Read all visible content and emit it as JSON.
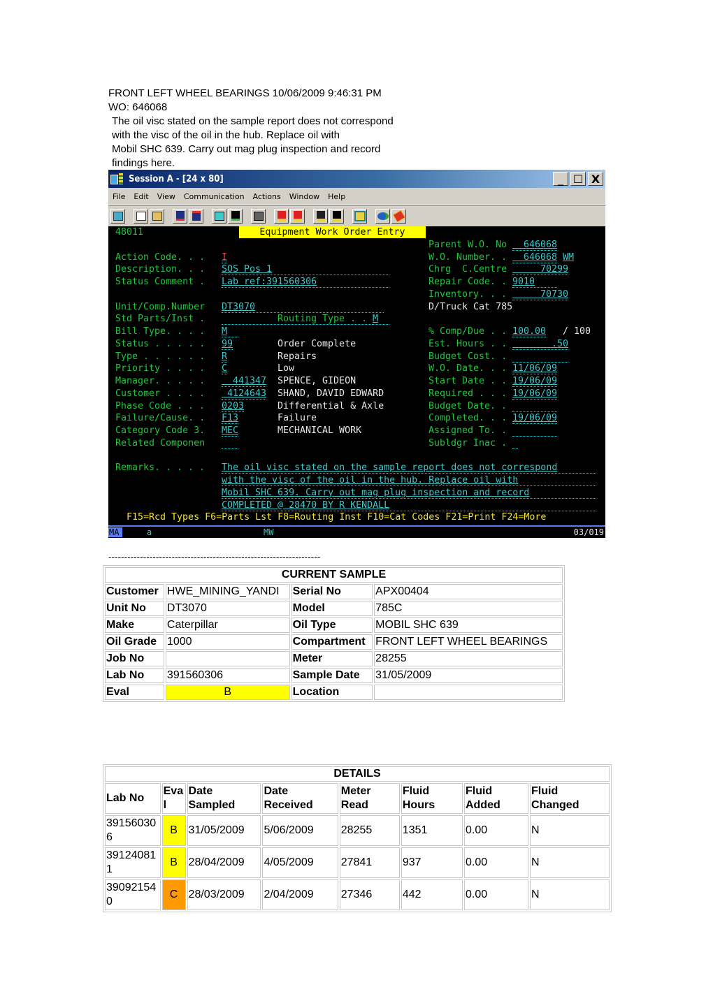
{
  "intro": {
    "heading": "FRONT LEFT WHEEL BEARINGS 10/06/2009 9:46:31 PM",
    "wo": "WO: 646068",
    "lines": [
      "The oil visc stated on the sample report does not correspond",
      "with the visc of the oil in the hub. Replace oil with",
      "Mobil SHC 639. Carry out mag plug inspection and record",
      "findings here."
    ]
  },
  "window": {
    "title": "Session A - [24 x 80]",
    "controls": {
      "minimize": "_",
      "maximize": "☐",
      "close": "X"
    },
    "menu": [
      "File",
      "Edit",
      "View",
      "Communication",
      "Actions",
      "Window",
      "Help"
    ],
    "toolbar": [
      "print-screen",
      "copy",
      "paste",
      "send",
      "receive",
      "display-setup",
      "color-map",
      "keyboard-map",
      "record-macro",
      "stop-macro",
      "play-macro",
      "quick-macro",
      "clipboard",
      "support",
      "help"
    ]
  },
  "terminal": {
    "program_id": "48011",
    "screen_title": "Equipment Work Order Entry",
    "left_fields": [
      {
        "label": "Action Code. . . ",
        "value": "I"
      },
      {
        "label": "Description. . . ",
        "value": "SOS Pos 1"
      },
      {
        "label": "Status Comment . ",
        "value": "Lab ref:391560306"
      },
      {
        "label": "Unit/Comp.Number ",
        "value": "DT3070"
      },
      {
        "label": "Std Parts/Inst . ",
        "value": ""
      },
      {
        "label": "Bill Type. . . . ",
        "value": "M"
      },
      {
        "label": "Status . . . . . ",
        "value": "99",
        "desc": "Order Complete"
      },
      {
        "label": "Type . . . . . . ",
        "value": "R",
        "desc": "Repairs"
      },
      {
        "label": "Priority . . . . ",
        "value": "C",
        "desc": "Low"
      },
      {
        "label": "Manager. . . . . ",
        "value": "  441347",
        "desc": "SPENCE, GIDEON"
      },
      {
        "label": "Customer . . . . ",
        "value": " 4124643",
        "desc": "SHAND, DAVID EDWARD"
      },
      {
        "label": "Phase Code . . . ",
        "value": "0203",
        "desc": "Differential & Axle"
      },
      {
        "label": "Failure/Cause. . ",
        "value": "F13",
        "desc": "Failure"
      },
      {
        "label": "Category Code 3. ",
        "value": "MEC",
        "desc": "MECHANICAL WORK"
      },
      {
        "label": "Related Componen ",
        "value": ""
      }
    ],
    "routing_type": {
      "label": "Routing Type . . ",
      "value": "M"
    },
    "right_fields": [
      {
        "label": "Parent W.O. No ",
        "value": "  646068"
      },
      {
        "label": "W.O. Number. . ",
        "value": "  646068",
        "suffix": "WM"
      },
      {
        "label": "Chrg  C.Centre ",
        "value": "     70299"
      },
      {
        "label": "Repair Code. . ",
        "value": "9010"
      },
      {
        "label": "Inventory. . . ",
        "value": "     70730"
      },
      {
        "label": "% Comp/Due . . ",
        "value": "100.00",
        "suffix": "/ 100"
      },
      {
        "label": "Est. Hours . . ",
        "value": "       .50"
      },
      {
        "label": "Budget Cost. . ",
        "value": ""
      },
      {
        "label": "W.O. Date. . . ",
        "value": "11/06/09"
      },
      {
        "label": "Start Date . . ",
        "value": "19/06/09"
      },
      {
        "label": "Required . . . ",
        "value": "19/06/09"
      },
      {
        "label": "Budget Date. . ",
        "value": ""
      },
      {
        "label": "Completed. . . ",
        "value": "19/06/09"
      },
      {
        "label": "Assigned To. . ",
        "value": ""
      },
      {
        "label": "Subldgr Inac . ",
        "value": ""
      }
    ],
    "unit_desc": "D/Truck Cat 785",
    "remarks_label": "Remarks. . . . . ",
    "remarks": [
      "The oil visc stated on the sample report does not correspond",
      "with the visc of the oil in the hub. Replace oil with",
      "Mobil SHC 639. Carry out mag plug inspection and record",
      "COMPLETED @ 28470 BY R KENDALL"
    ],
    "fkeys": "F15=Rcd Types F6=Parts Lst F8=Routing Inst F10=Cat Codes F21=Print F24=More",
    "status": {
      "mode": "MA",
      "indicator": "a",
      "session": "MW",
      "cursor_pos": "03/019"
    }
  },
  "separator": "-------------------------------------------------------------------",
  "current_sample": {
    "caption": "CURRENT SAMPLE",
    "rows": [
      [
        "Customer",
        "HWE_MINING_YANDI",
        "Serial No",
        "APX00404"
      ],
      [
        "Unit No",
        "DT3070",
        "Model",
        "785C"
      ],
      [
        "Make",
        "Caterpillar",
        "Oil Type",
        "MOBIL SHC 639"
      ],
      [
        "Oil Grade",
        "1000",
        "Compartment",
        "FRONT LEFT WHEEL BEARINGS"
      ],
      [
        "Job No",
        "",
        "Meter",
        "28255"
      ],
      [
        "Lab No",
        "391560306",
        "Sample Date",
        "31/05/2009"
      ],
      [
        "Eval",
        "B",
        "Location",
        ""
      ]
    ],
    "eval_color": "#ffff00"
  },
  "details": {
    "caption": "DETAILS",
    "headers": [
      "Lab No",
      "Eva l",
      "Date Sampled",
      "Date Received",
      "Meter Read",
      "Fluid Hours",
      "Fluid Added",
      "Fluid Changed"
    ],
    "rows": [
      {
        "lab_no": "391560306",
        "eval": "B",
        "date_sampled": "31/05/2009",
        "date_received": "5/06/2009",
        "meter_read": "28255",
        "fluid_hours": "1351",
        "fluid_added": "0.00",
        "fluid_changed": "N",
        "eval_color": "#ffff00"
      },
      {
        "lab_no": "391240811",
        "eval": "B",
        "date_sampled": "28/04/2009",
        "date_received": "4/05/2009",
        "meter_read": "27841",
        "fluid_hours": "937",
        "fluid_added": "0.00",
        "fluid_changed": "N",
        "eval_color": "#ffff00"
      },
      {
        "lab_no": "390921540",
        "eval": "C",
        "date_sampled": "28/03/2009",
        "date_received": "2/04/2009",
        "meter_read": "27346",
        "fluid_hours": "442",
        "fluid_added": "0.00",
        "fluid_changed": "N",
        "eval_color": "#ff9900"
      }
    ]
  }
}
